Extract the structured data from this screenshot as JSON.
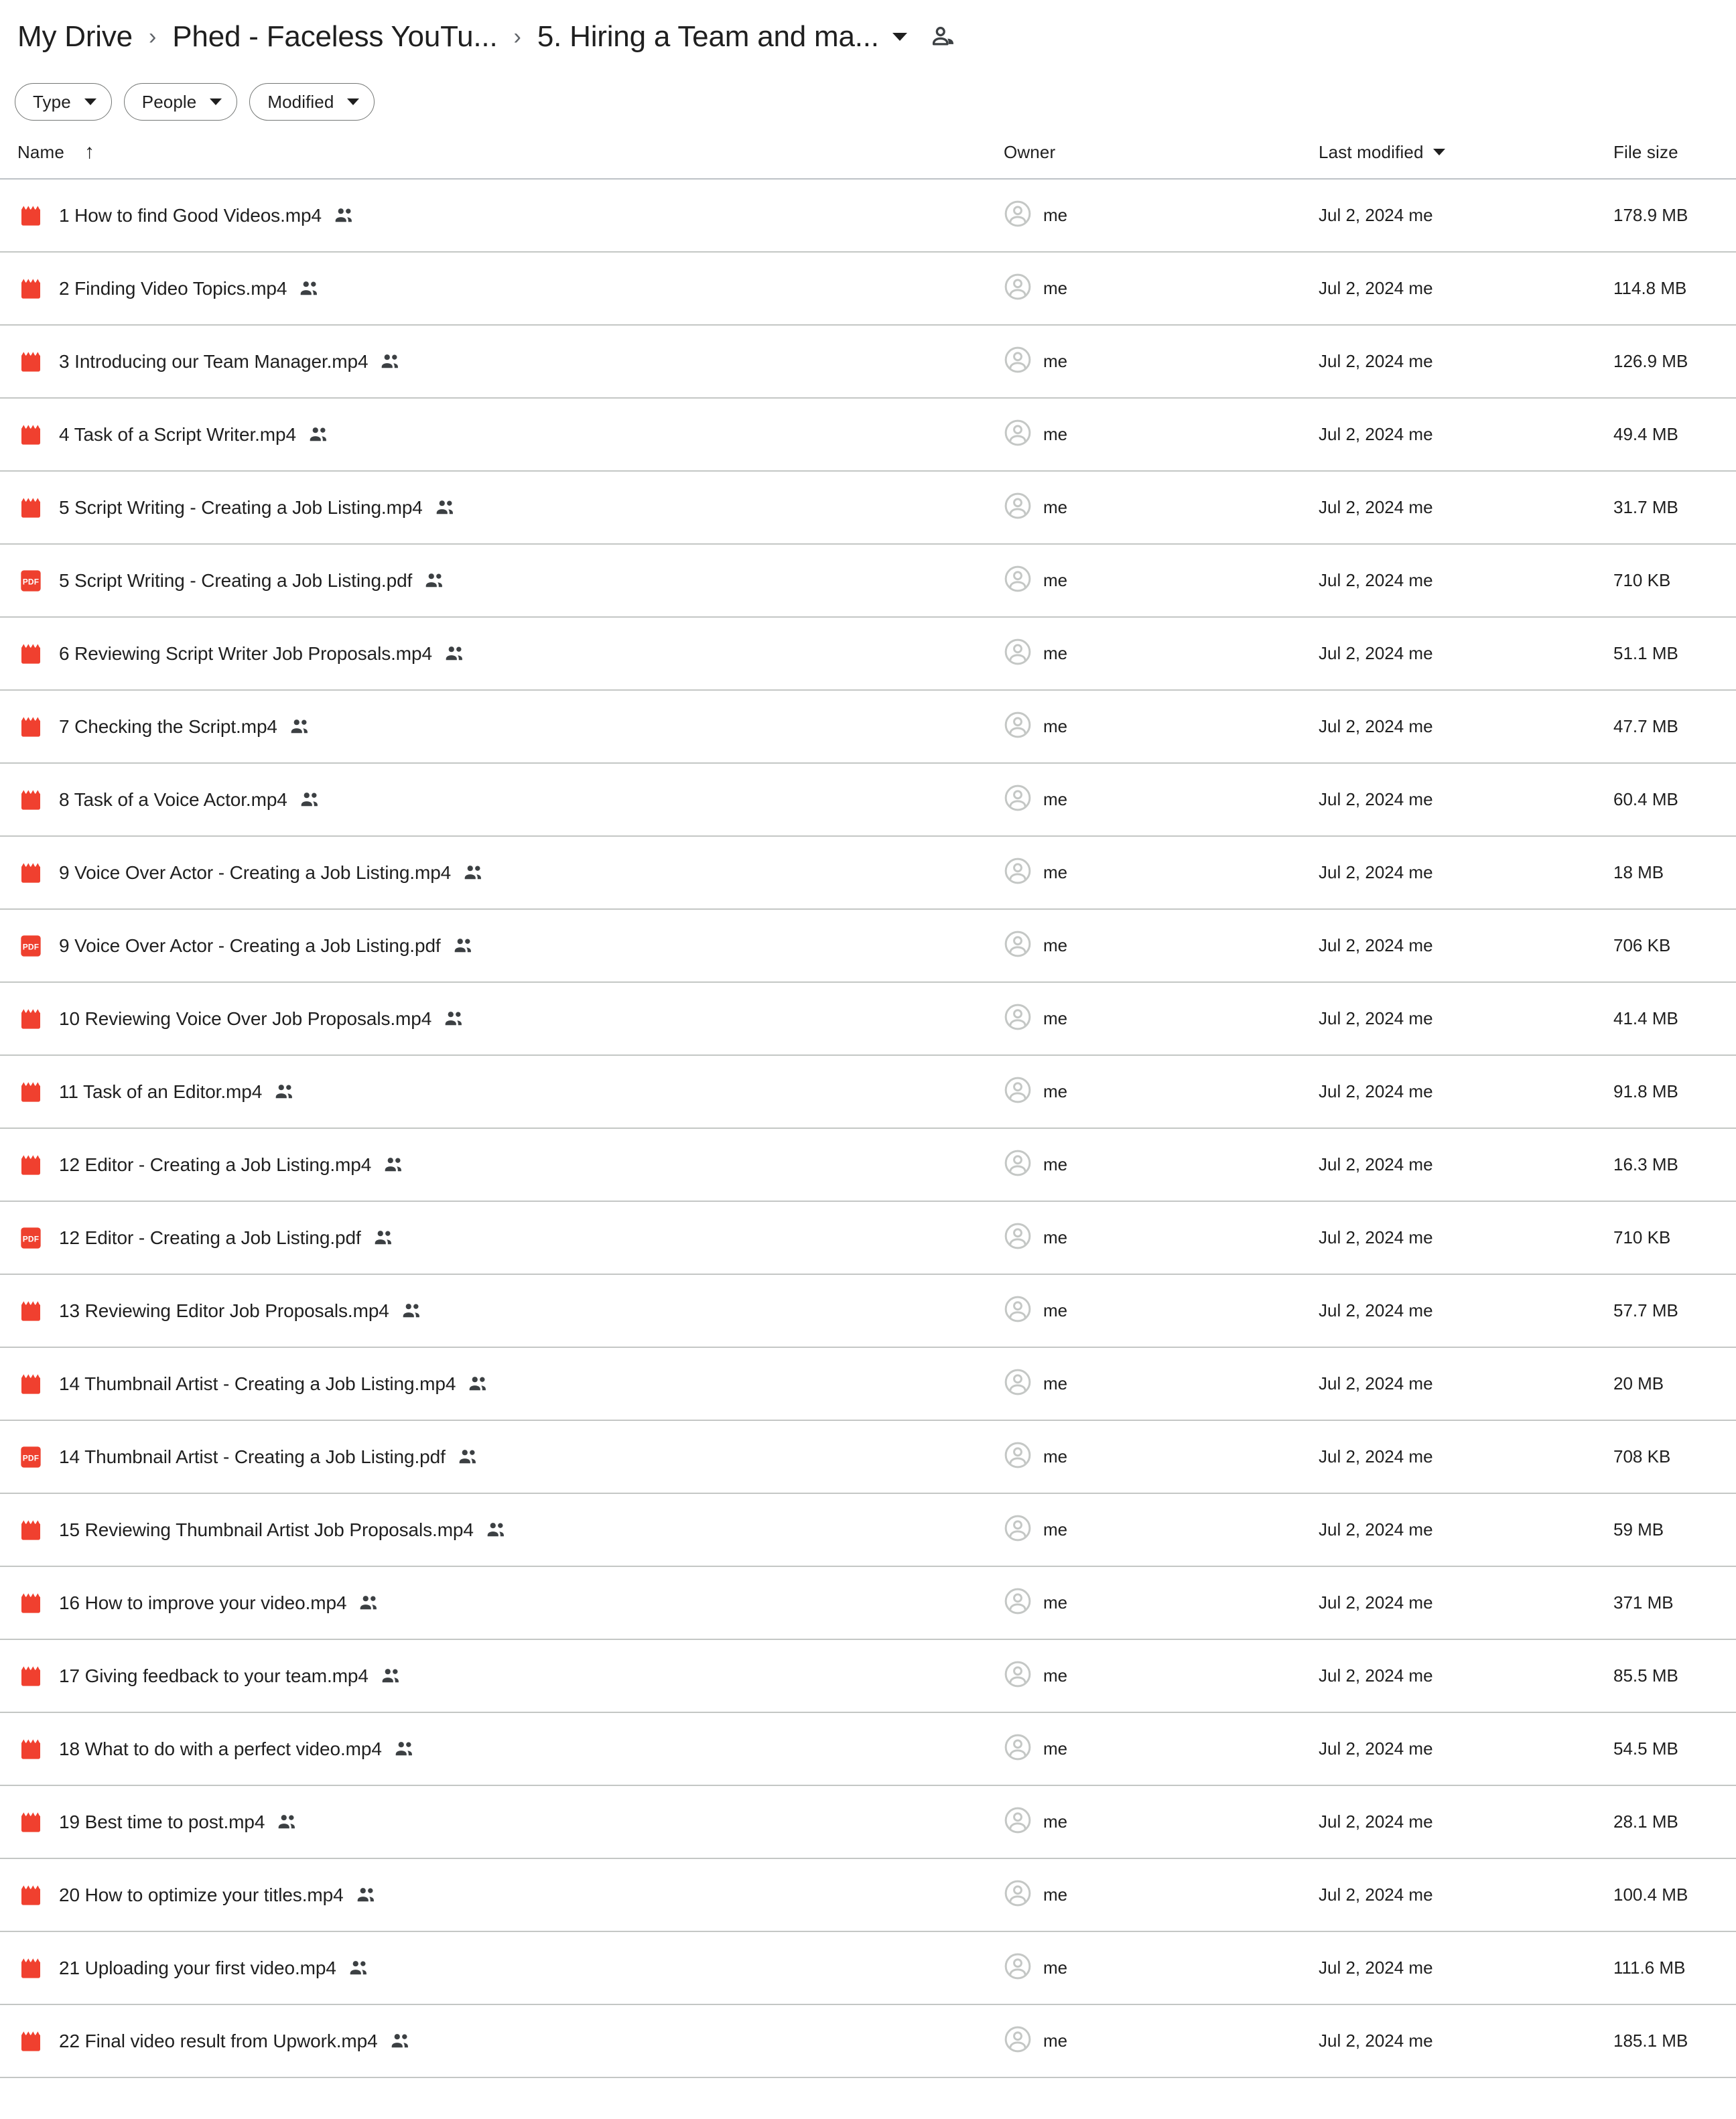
{
  "breadcrumb": {
    "items": [
      {
        "label": "My Drive"
      },
      {
        "label": "Phed - Faceless YouTu..."
      },
      {
        "label": "5. Hiring a Team and ma..."
      }
    ],
    "separator": "›",
    "share_icon": "people-share-icon",
    "dropdown_icon": "chevron-down-icon"
  },
  "filters": [
    {
      "label": "Type",
      "icon": "chevron-down-icon"
    },
    {
      "label": "People",
      "icon": "chevron-down-icon"
    },
    {
      "label": "Modified",
      "icon": "chevron-down-icon"
    }
  ],
  "columns": {
    "name": "Name",
    "name_sort_icon": "↑",
    "owner": "Owner",
    "modified": "Last modified",
    "modified_sort_icon": "chevron-down-icon",
    "size": "File size"
  },
  "colors": {
    "video_red": "#F0402F",
    "pdf_red": "#EE402E",
    "text": "#1f1f1f",
    "divider": "#c4c7c5",
    "avatar_gray": "#c4c7c5",
    "shared_gray": "#3c4043"
  },
  "rows": [
    {
      "type": "video",
      "name": "1 How to find Good Videos.mp4",
      "shared": "shared-icon",
      "owner_avatar": "person-avatar",
      "owner": "me",
      "modified": "Jul 2, 2024  me",
      "size": "178.9 MB"
    },
    {
      "type": "video",
      "name": "2 Finding Video Topics.mp4",
      "shared": "shared-icon",
      "owner_avatar": "person-avatar",
      "owner": "me",
      "modified": "Jul 2, 2024  me",
      "size": "114.8 MB"
    },
    {
      "type": "video",
      "name": "3 Introducing our Team Manager.mp4",
      "shared": "shared-icon",
      "owner_avatar": "person-avatar",
      "owner": "me",
      "modified": "Jul 2, 2024  me",
      "size": "126.9 MB"
    },
    {
      "type": "video",
      "name": "4 Task of a Script Writer.mp4",
      "shared": "shared-icon",
      "owner_avatar": "person-avatar",
      "owner": "me",
      "modified": "Jul 2, 2024  me",
      "size": "49.4 MB"
    },
    {
      "type": "video",
      "name": "5 Script Writing - Creating a Job Listing.mp4",
      "shared": "shared-icon",
      "owner_avatar": "person-avatar",
      "owner": "me",
      "modified": "Jul 2, 2024  me",
      "size": "31.7 MB"
    },
    {
      "type": "pdf",
      "name": "5 Script Writing - Creating a Job Listing.pdf",
      "shared": "shared-icon",
      "owner_avatar": "person-avatar",
      "owner": "me",
      "modified": "Jul 2, 2024  me",
      "size": "710 KB"
    },
    {
      "type": "video",
      "name": "6 Reviewing Script Writer Job Proposals.mp4",
      "shared": "shared-icon",
      "owner_avatar": "person-avatar",
      "owner": "me",
      "modified": "Jul 2, 2024  me",
      "size": "51.1 MB"
    },
    {
      "type": "video",
      "name": "7 Checking the Script.mp4",
      "shared": "shared-icon",
      "owner_avatar": "person-avatar",
      "owner": "me",
      "modified": "Jul 2, 2024  me",
      "size": "47.7 MB"
    },
    {
      "type": "video",
      "name": "8 Task of a Voice Actor.mp4",
      "shared": "shared-icon",
      "owner_avatar": "person-avatar",
      "owner": "me",
      "modified": "Jul 2, 2024  me",
      "size": "60.4 MB"
    },
    {
      "type": "video",
      "name": "9 Voice Over Actor - Creating a Job Listing.mp4",
      "shared": "shared-icon",
      "owner_avatar": "person-avatar",
      "owner": "me",
      "modified": "Jul 2, 2024  me",
      "size": "18 MB"
    },
    {
      "type": "pdf",
      "name": "9 Voice Over Actor - Creating a Job Listing.pdf",
      "shared": "shared-icon",
      "owner_avatar": "person-avatar",
      "owner": "me",
      "modified": "Jul 2, 2024  me",
      "size": "706 KB"
    },
    {
      "type": "video",
      "name": "10 Reviewing Voice Over Job Proposals.mp4",
      "shared": "shared-icon",
      "owner_avatar": "person-avatar",
      "owner": "me",
      "modified": "Jul 2, 2024  me",
      "size": "41.4 MB"
    },
    {
      "type": "video",
      "name": "11 Task of an Editor.mp4",
      "shared": "shared-icon",
      "owner_avatar": "person-avatar",
      "owner": "me",
      "modified": "Jul 2, 2024  me",
      "size": "91.8 MB"
    },
    {
      "type": "video",
      "name": "12 Editor - Creating a Job Listing.mp4",
      "shared": "shared-icon",
      "owner_avatar": "person-avatar",
      "owner": "me",
      "modified": "Jul 2, 2024  me",
      "size": "16.3 MB"
    },
    {
      "type": "pdf",
      "name": "12 Editor - Creating a Job Listing.pdf",
      "shared": "shared-icon",
      "owner_avatar": "person-avatar",
      "owner": "me",
      "modified": "Jul 2, 2024  me",
      "size": "710 KB"
    },
    {
      "type": "video",
      "name": "13 Reviewing Editor Job Proposals.mp4",
      "shared": "shared-icon",
      "owner_avatar": "person-avatar",
      "owner": "me",
      "modified": "Jul 2, 2024  me",
      "size": "57.7 MB"
    },
    {
      "type": "video",
      "name": "14 Thumbnail Artist - Creating a Job Listing.mp4",
      "shared": "shared-icon",
      "owner_avatar": "person-avatar",
      "owner": "me",
      "modified": "Jul 2, 2024  me",
      "size": "20 MB"
    },
    {
      "type": "pdf",
      "name": "14 Thumbnail Artist - Creating a Job Listing.pdf",
      "shared": "shared-icon",
      "owner_avatar": "person-avatar",
      "owner": "me",
      "modified": "Jul 2, 2024  me",
      "size": "708 KB"
    },
    {
      "type": "video",
      "name": "15 Reviewing Thumbnail Artist Job Proposals.mp4",
      "shared": "shared-icon",
      "owner_avatar": "person-avatar",
      "owner": "me",
      "modified": "Jul 2, 2024  me",
      "size": "59 MB"
    },
    {
      "type": "video",
      "name": "16 How to improve your video.mp4",
      "shared": "shared-icon",
      "owner_avatar": "person-avatar",
      "owner": "me",
      "modified": "Jul 2, 2024  me",
      "size": "371 MB"
    },
    {
      "type": "video",
      "name": "17 Giving feedback to your team.mp4",
      "shared": "shared-icon",
      "owner_avatar": "person-avatar",
      "owner": "me",
      "modified": "Jul 2, 2024  me",
      "size": "85.5 MB"
    },
    {
      "type": "video",
      "name": "18 What to do with a perfect video.mp4",
      "shared": "shared-icon",
      "owner_avatar": "person-avatar",
      "owner": "me",
      "modified": "Jul 2, 2024  me",
      "size": "54.5 MB"
    },
    {
      "type": "video",
      "name": "19 Best time to post.mp4",
      "shared": "shared-icon",
      "owner_avatar": "person-avatar",
      "owner": "me",
      "modified": "Jul 2, 2024  me",
      "size": "28.1 MB"
    },
    {
      "type": "video",
      "name": "20 How to optimize your titles.mp4",
      "shared": "shared-icon",
      "owner_avatar": "person-avatar",
      "owner": "me",
      "modified": "Jul 2, 2024  me",
      "size": "100.4 MB"
    },
    {
      "type": "video",
      "name": "21 Uploading your first video.mp4",
      "shared": "shared-icon",
      "owner_avatar": "person-avatar",
      "owner": "me",
      "modified": "Jul 2, 2024  me",
      "size": "111.6 MB"
    },
    {
      "type": "video",
      "name": "22 Final video result from Upwork.mp4",
      "shared": "shared-icon",
      "owner_avatar": "person-avatar",
      "owner": "me",
      "modified": "Jul 2, 2024  me",
      "size": "185.1 MB"
    }
  ]
}
